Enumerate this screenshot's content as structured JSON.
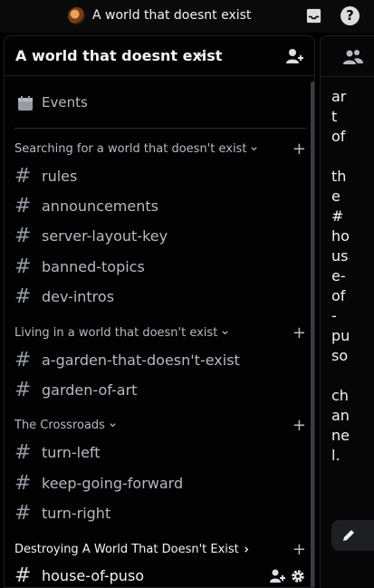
{
  "topbar": {
    "title": "A world that doesnt exist",
    "icons": [
      "server-avatar",
      "inbox-icon",
      "help-icon"
    ]
  },
  "server": {
    "name": "A world that doesnt exist"
  },
  "events": {
    "label": "Events"
  },
  "categories": [
    {
      "label": "Searching for a world that doesn't exist",
      "channels": [
        "rules",
        "announcements",
        "server-layout-key",
        "banned-topics",
        "dev-intros"
      ]
    },
    {
      "label": "Living in a world that doesn't exist",
      "channels": [
        "a-garden-that-doesn't-exist",
        "garden-of-art"
      ]
    },
    {
      "label": "The Crossroads",
      "channels": [
        "turn-left",
        "keep-going-forward",
        "turn-right"
      ]
    },
    {
      "label": "Destroying A World That Doesn't Exist",
      "channels": [
        "house-of-puso"
      ]
    }
  ],
  "channel_hash": "#",
  "plus": "+",
  "right_text": [
    "ar",
    "t",
    "of",
    "",
    "th",
    "e",
    "#",
    "ho",
    "us",
    "e-",
    "of",
    "-",
    "pu",
    "so",
    "",
    "ch",
    "an",
    "ne",
    "l."
  ],
  "colors": {
    "background": "#000000",
    "text": "#dbdee1",
    "muted": "#b5bac1"
  }
}
